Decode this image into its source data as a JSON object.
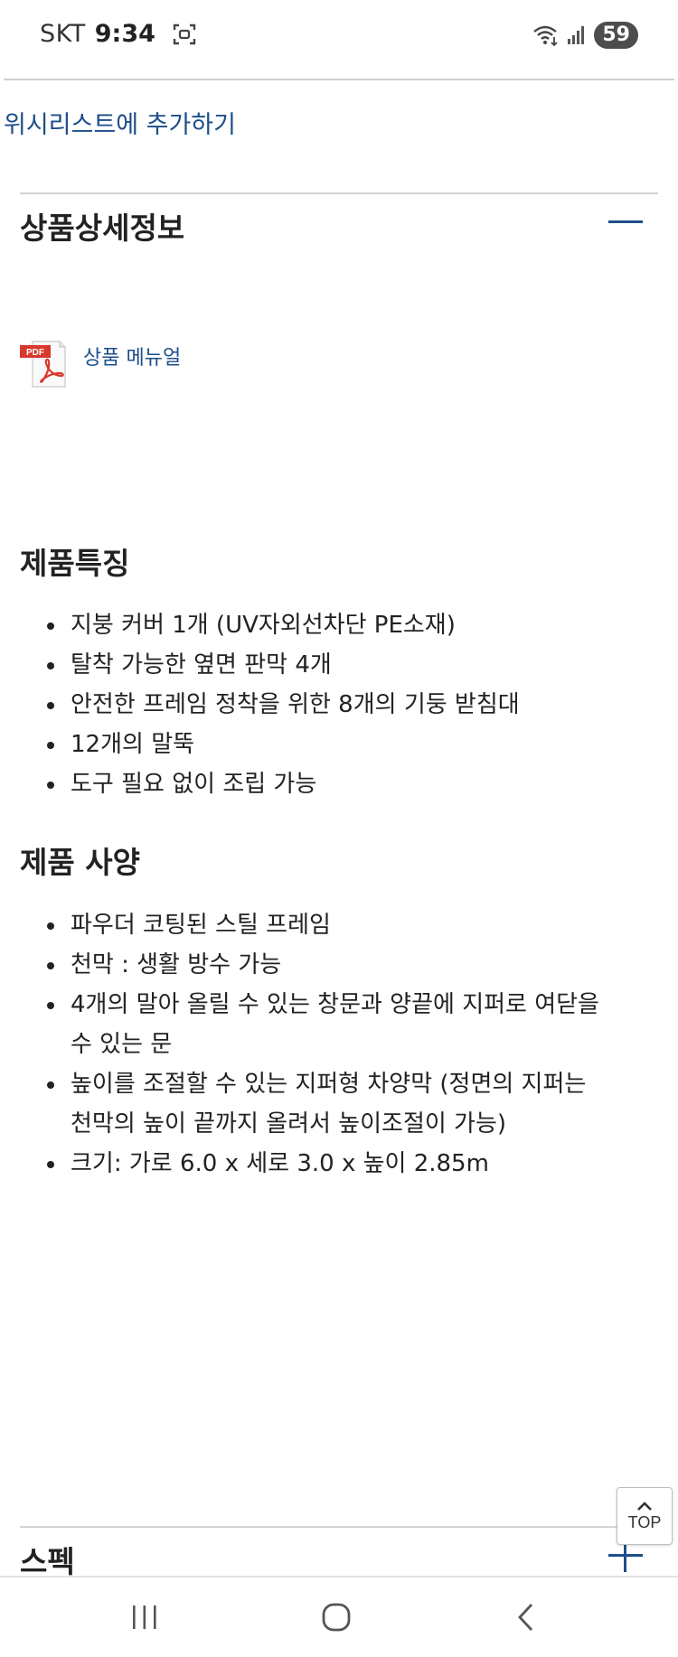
{
  "status_bar": {
    "carrier": "SKT",
    "time": "9:34",
    "battery": "59"
  },
  "wishlist": {
    "label": "위시리스트에 추가하기"
  },
  "detail_section": {
    "title": "상품상세정보",
    "pdf_badge": "PDF",
    "manual_link": "상품 메뉴얼",
    "features": {
      "heading": "제품특징",
      "items": [
        "지붕 커버 1개 (UV자외선차단 PE소재)",
        "탈착 가능한 옆면 판막 4개",
        "안전한 프레임 정착을 위한 8개의 기둥 받침대",
        "12개의 말뚝",
        "도구 필요 없이 조립 가능"
      ]
    },
    "specs": {
      "heading": "제품 사양",
      "items": [
        "파우더 코팅된 스틸 프레임",
        "천막 : 생활 방수 가능",
        "4개의 말아 올릴 수 있는 창문과 양끝에 지퍼로 여닫을 수 있는 문",
        "높이를 조절할 수 있는 지퍼형 차양막 (정면의 지퍼는 천막의 높이 끝까지 올려서 높이조절이 가능)",
        "크기: 가로 6.0 x 세로 3.0 x 높이 2.85m"
      ]
    }
  },
  "spec_section": {
    "title": "스펙"
  },
  "top_button": {
    "label": "TOP"
  },
  "colors": {
    "link": "#1d4e89",
    "text": "#222222",
    "divider": "#d4d4d4",
    "pdf_red": "#d9382c"
  },
  "icons": {
    "screenshot": "screenshot-icon",
    "wifi": "wifi-icon",
    "signal": "signal-icon",
    "pdf": "pdf-icon",
    "collapse": "minus-icon",
    "expand": "plus-icon",
    "top": "chevron-up-icon",
    "recent": "recent-apps-icon",
    "home": "home-icon",
    "back": "back-icon"
  }
}
